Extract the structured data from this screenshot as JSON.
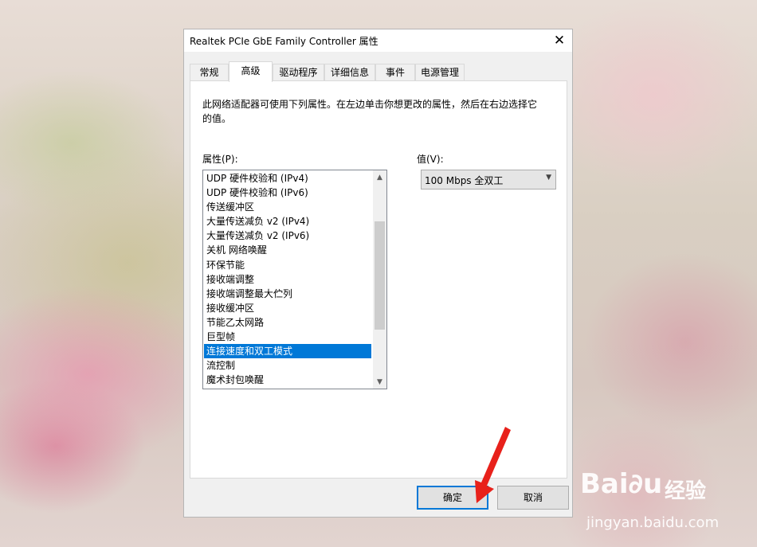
{
  "window": {
    "title": "Realtek PCIe GbE Family Controller 属性",
    "close_glyph": "✕"
  },
  "tabs": [
    {
      "label": "常规",
      "active": false
    },
    {
      "label": "高级",
      "active": true
    },
    {
      "label": "驱动程序",
      "active": false
    },
    {
      "label": "详细信息",
      "active": false
    },
    {
      "label": "事件",
      "active": false
    },
    {
      "label": "电源管理",
      "active": false
    }
  ],
  "panel": {
    "description": "此网络适配器可使用下列属性。在左边单击你想更改的属性，然后在右边选择它的值。",
    "property_label": "属性(P):",
    "value_label": "值(V):",
    "properties": [
      "UDP 硬件校验和 (IPv4)",
      "UDP 硬件校验和 (IPv6)",
      "传送缓冲区",
      "大量传送减负 v2 (IPv4)",
      "大量传送减负 v2 (IPv6)",
      "关机 网络唤醒",
      "环保节能",
      "接收端调整",
      "接收端调整最大伫列",
      "接收缓冲区",
      "节能乙太网路",
      "巨型帧",
      "连接速度和双工模式",
      "流控制",
      "魔术封包唤醒"
    ],
    "selected_property": "连接速度和双工模式",
    "value_selected": "100 Mbps 全双工"
  },
  "buttons": {
    "ok": "确定",
    "cancel": "取消"
  },
  "watermark": {
    "logo": "Bai∂u",
    "brand_cn": "经验",
    "url": "jingyan.baidu.com"
  },
  "colors": {
    "selection": "#0078d7",
    "annotation_arrow": "#e8211b"
  }
}
